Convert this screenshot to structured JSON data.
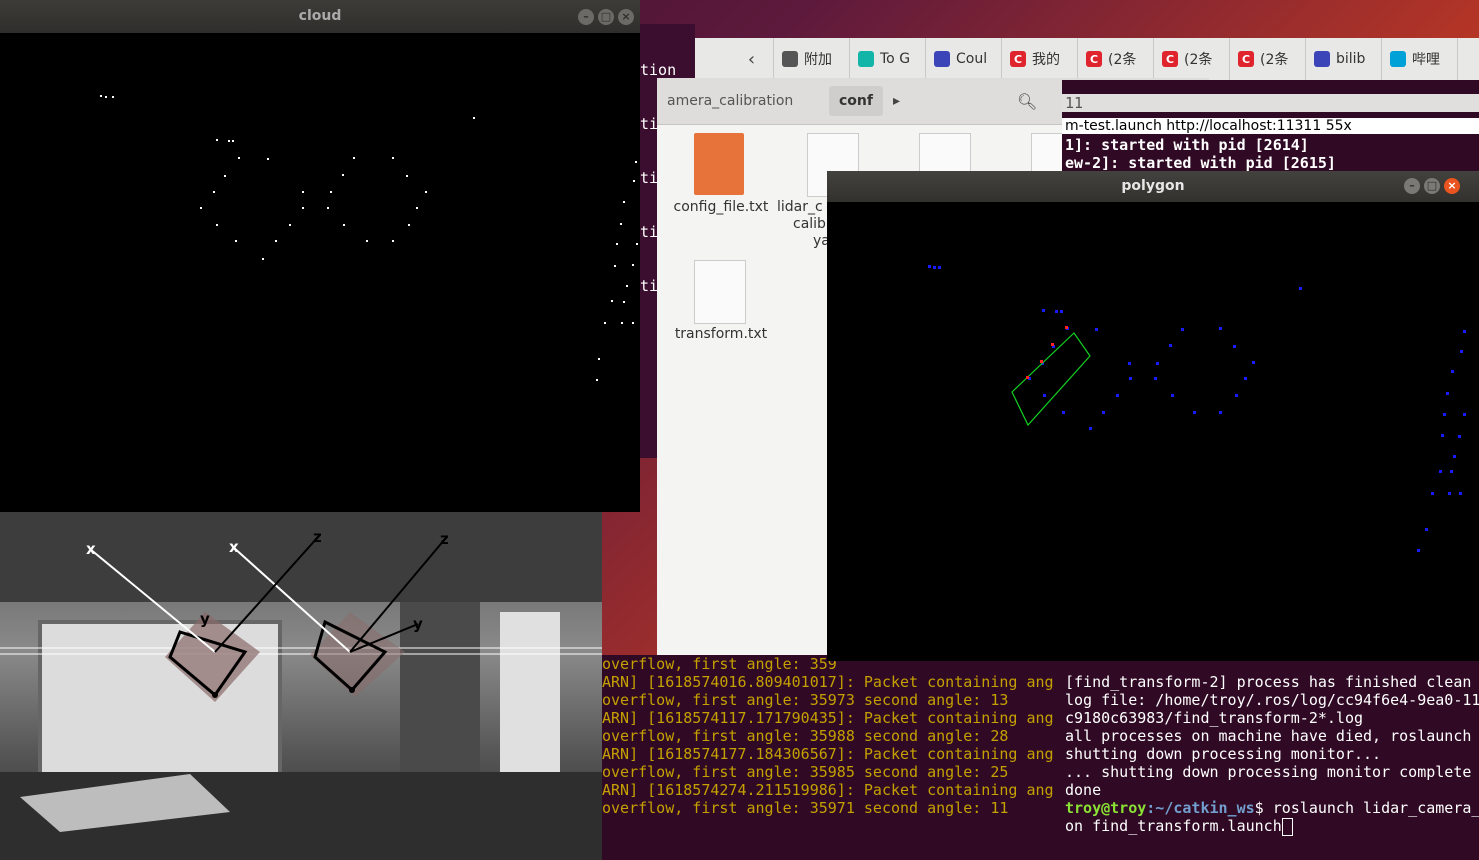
{
  "browser_tabs": [
    {
      "label": "附加",
      "icon": "puzzle-icon",
      "color": "#555555"
    },
    {
      "label": "To G",
      "icon": "puzzle-teal-icon",
      "color": "#12b5a8"
    },
    {
      "label": "Coul",
      "icon": "baidu-paw-icon",
      "color": "#3b45b8"
    },
    {
      "label": "我的",
      "icon": "csdn-icon",
      "color": "#e0242e"
    },
    {
      "label": "(2条",
      "icon": "csdn-icon",
      "color": "#e0242e"
    },
    {
      "label": "(2条",
      "icon": "csdn-icon",
      "color": "#e0242e"
    },
    {
      "label": "(2条",
      "icon": "csdn-icon",
      "color": "#e0242e"
    },
    {
      "label": "bilib",
      "icon": "baidu-paw-icon",
      "color": "#3b45b8"
    },
    {
      "label": "哔哩",
      "icon": "bilibili-icon",
      "color": "#00a1d6"
    }
  ],
  "term_left": {
    "lines": [
      "tion",
      "tion",
      "tion",
      "tion",
      "tion"
    ]
  },
  "files": {
    "breadcrumb_prev": "amera_calibration",
    "breadcrumb_current": "conf",
    "items": [
      {
        "label": "config_file.txt"
      },
      {
        "label": "lidar_c"
      },
      {
        "label": "calib"
      },
      {
        "label": "ya"
      },
      {
        "label": "transform.txt"
      }
    ]
  },
  "cloud_window": {
    "title": "cloud"
  },
  "polygon_window": {
    "title": "polygon"
  },
  "camera": {
    "axis_labels": [
      "x",
      "z",
      "x",
      "z",
      "y",
      "y"
    ]
  },
  "term_bottom": {
    "lines": [
      "overflow, first angle: 359",
      "ARN] [1618574016.809401017]: Packet containing ang",
      "overflow, first angle: 35973 second angle: 13",
      "ARN] [1618574117.171790435]: Packet containing ang",
      "overflow, first angle: 35988 second angle: 28",
      "ARN] [1618574177.184306567]: Packet containing ang",
      "overflow, first angle: 35985 second angle: 25",
      "ARN] [1618574274.211519986]: Packet containing ang",
      "overflow, first angle: 35971 second angle: 11"
    ]
  },
  "term_right": {
    "top_title": "11",
    "top_lines": [
      "m-test.launch http://localhost:11311 55x",
      "1]: started with pid [2614]",
      "ew-2]: started with pid [2615]"
    ],
    "bottom_lines": [
      "[find_transform-2] process has finished clean",
      "log file: /home/troy/.ros/log/cc94f6e4-9ea0-11",
      "c9180c63983/find_transform-2*.log",
      "all processes on machine have died, roslaunch",
      "shutting down processing monitor...",
      "... shutting down processing monitor complete",
      "done"
    ],
    "prompt_user": "troy@troy",
    "prompt_path": ":~/catkin_ws",
    "prompt_cmd": "$ roslaunch lidar_camera_",
    "prompt_cont": "on find_transform.launch"
  }
}
